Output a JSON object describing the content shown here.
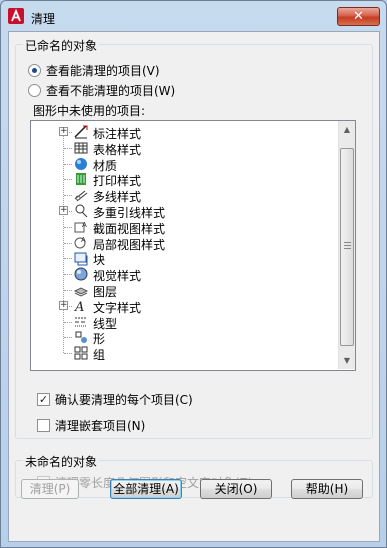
{
  "window": {
    "title": "清理",
    "close_glyph": "✕"
  },
  "named_group": {
    "label": "已命名的对象",
    "radio_purgeable": "查看能清理的项目(V)",
    "radio_nonpurgeable": "查看不能清理的项目(W)",
    "tree_caption": "图形中未使用的项目:",
    "tree_items": [
      {
        "label": "标注样式",
        "expandable": true,
        "icon": "dimstyle-icon"
      },
      {
        "label": "表格样式",
        "expandable": false,
        "icon": "tablestyle-icon"
      },
      {
        "label": "材质",
        "expandable": false,
        "icon": "material-icon"
      },
      {
        "label": "打印样式",
        "expandable": false,
        "icon": "plotstyle-icon"
      },
      {
        "label": "多线样式",
        "expandable": false,
        "icon": "mlinestyle-icon"
      },
      {
        "label": "多重引线样式",
        "expandable": true,
        "icon": "mleaderstyle-icon"
      },
      {
        "label": "截面视图样式",
        "expandable": false,
        "icon": "sectionview-icon"
      },
      {
        "label": "局部视图样式",
        "expandable": false,
        "icon": "detailview-icon"
      },
      {
        "label": "块",
        "expandable": false,
        "icon": "block-icon"
      },
      {
        "label": "视觉样式",
        "expandable": false,
        "icon": "visualstyle-icon"
      },
      {
        "label": "图层",
        "expandable": false,
        "icon": "layer-icon"
      },
      {
        "label": "文字样式",
        "expandable": true,
        "icon": "textstyle-icon"
      },
      {
        "label": "线型",
        "expandable": false,
        "icon": "linetype-icon"
      },
      {
        "label": "形",
        "expandable": false,
        "icon": "shape-icon"
      },
      {
        "label": "组",
        "expandable": false,
        "icon": "group-icon"
      }
    ],
    "check_confirm": "确认要清理的每个项目(C)",
    "check_nested": "清理嵌套项目(N)"
  },
  "unnamed_group": {
    "label": "未命名的对象",
    "check_zero_length": "清理零长度几何图形和空文字对象(Z)"
  },
  "buttons": {
    "purge": "清理(P)",
    "purge_all": "全部清理(A)",
    "close": "关闭(O)",
    "help": "帮助(H)"
  },
  "colors": {
    "accent": "#1a4a8c",
    "close_red": "#c53b22",
    "title_bar": "#c7dbef"
  }
}
